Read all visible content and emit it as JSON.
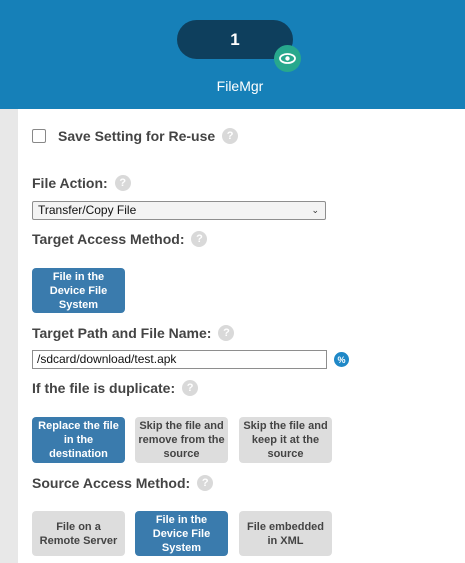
{
  "header": {
    "step_number": "1",
    "title": "FileMgr",
    "badge_icon": "eye-icon",
    "background_color": "#1680b8"
  },
  "save_setting": {
    "label": "Save Setting for Re-use",
    "checked": false
  },
  "file_action": {
    "label": "File Action:",
    "selected": "Transfer/Copy File"
  },
  "target_access": {
    "label": "Target Access Method:",
    "options": [
      "File in the Device File System"
    ],
    "selected_index": 0
  },
  "target_path": {
    "label": "Target Path and File Name:",
    "value": "/sdcard/download/test.apk"
  },
  "duplicate": {
    "label": "If the file is duplicate:",
    "options": [
      "Replace the file in the destination",
      "Skip the file and remove from the source",
      "Skip the file and keep it at the source"
    ],
    "selected_index": 0
  },
  "source_access": {
    "label": "Source Access Method:",
    "options": [
      "File on a Remote Server",
      "File in the Device File System",
      "File embedded in XML"
    ],
    "selected_index": 1
  },
  "help_glyph": "?",
  "variable_glyph": "%",
  "colors": {
    "active_button": "#3a7bad",
    "inactive_button": "#dddddd",
    "step_pill": "#0e3f5d",
    "badge": "#27a88d"
  }
}
